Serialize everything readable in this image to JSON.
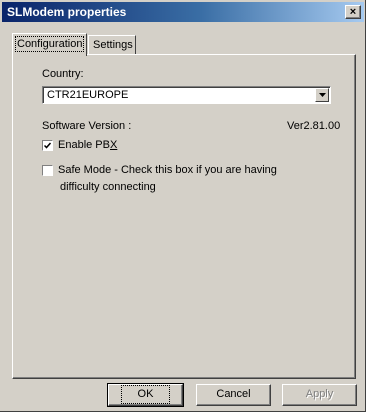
{
  "window": {
    "title": "SLModem properties",
    "close_glyph": "×"
  },
  "tabs": [
    {
      "label": "Configuration",
      "active": true
    },
    {
      "label": "Settings",
      "active": false
    }
  ],
  "configuration": {
    "country_label": "Country:",
    "country_value": "CTR21EUROPE",
    "software_version_label": "Software Version :",
    "software_version_value": "Ver2.81.00",
    "enable_pbx": {
      "label_prefix": "Enable PB",
      "label_underlined": "X",
      "checked": true
    },
    "safe_mode": {
      "line1": "Safe Mode - Check this box if you are having",
      "line2": "difficulty connecting",
      "checked": false
    }
  },
  "buttons": {
    "ok": "OK",
    "cancel": "Cancel",
    "apply": "Apply"
  },
  "icons": {
    "close": "close-icon",
    "dropdown": "chevron-down-icon",
    "check": "checkmark-icon"
  }
}
